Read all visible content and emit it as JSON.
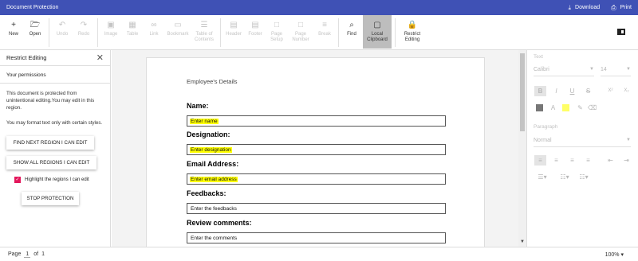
{
  "titlebar": {
    "title": "Document Protection",
    "download_label": "Download",
    "print_label": "Print",
    "download_icon": "download-icon",
    "print_icon": "printer-icon"
  },
  "toolbar": {
    "items": [
      {
        "id": "new",
        "label": "New",
        "icon": "+",
        "enabled": true
      },
      {
        "id": "open",
        "label": "Open",
        "icon": "🗁",
        "enabled": true
      },
      {
        "id": "undo",
        "label": "Undo",
        "icon": "↶",
        "enabled": false
      },
      {
        "id": "redo",
        "label": "Redo",
        "icon": "↷",
        "enabled": false
      },
      {
        "id": "image",
        "label": "Image",
        "icon": "▣",
        "enabled": false
      },
      {
        "id": "table",
        "label": "Table",
        "icon": "▦",
        "enabled": false
      },
      {
        "id": "link",
        "label": "Link",
        "icon": "∞",
        "enabled": false
      },
      {
        "id": "bookmark",
        "label": "Bookmark",
        "icon": "▭",
        "enabled": false
      },
      {
        "id": "toc",
        "label": "Table of Contents",
        "icon": "☰",
        "enabled": false
      },
      {
        "id": "header",
        "label": "Header",
        "icon": "▤",
        "enabled": false
      },
      {
        "id": "footer",
        "label": "Footer",
        "icon": "▤",
        "enabled": false
      },
      {
        "id": "page_setup",
        "label": "Page Setup",
        "icon": "□",
        "enabled": false
      },
      {
        "id": "page_number",
        "label": "Page Number",
        "icon": "□",
        "enabled": false
      },
      {
        "id": "break",
        "label": "Break",
        "icon": "≡",
        "enabled": false
      },
      {
        "id": "find",
        "label": "Find",
        "icon": "⌕",
        "enabled": true
      },
      {
        "id": "local_clipboard",
        "label": "Local Clipboard",
        "icon": "▢",
        "enabled": true,
        "selected": true
      },
      {
        "id": "restrict_editing",
        "label": "Restrict Editing",
        "icon": "🔒",
        "enabled": true
      }
    ]
  },
  "left_pane": {
    "title": "Restrict Editing",
    "permissions_heading": "Your permissions",
    "protected_text": "This document is protected from unintentional editing.You may edit in this region.",
    "format_text": "You may format text only with certain styles.",
    "find_next_button": "FIND NEXT REGION I CAN EDIT",
    "show_all_button": "SHOW ALL REGIONS I CAN EDIT",
    "highlight_label": "Highlight the regions I can edit",
    "highlight_checked": true,
    "stop_button": "STOP PROTECTION"
  },
  "document": {
    "heading": "Employee's Details",
    "fields": [
      {
        "label": "Name:",
        "value": "Enter name",
        "highlighted": true
      },
      {
        "label": "Designation:",
        "value": "Enter designation",
        "highlighted": true
      },
      {
        "label": "Email Address:",
        "value": "Enter email address",
        "highlighted": true
      },
      {
        "label": "Feedbacks:",
        "value": "Enter the feedbacks",
        "highlighted": false
      },
      {
        "label": "Review comments:",
        "value": "Enter the comments",
        "highlighted": false
      }
    ]
  },
  "right_pane": {
    "text_caption": "Text",
    "font_family": "Calibri",
    "font_size": "14",
    "paragraph_caption": "Paragraph",
    "style": "Normal"
  },
  "status": {
    "page_label": "Page",
    "page_number": "1",
    "of_label": "of",
    "page_total": "1",
    "zoom": "100%"
  },
  "colors": {
    "titlebar": "#3f51b5",
    "highlight": "#ffff00",
    "checkbox": "#e3165b"
  }
}
